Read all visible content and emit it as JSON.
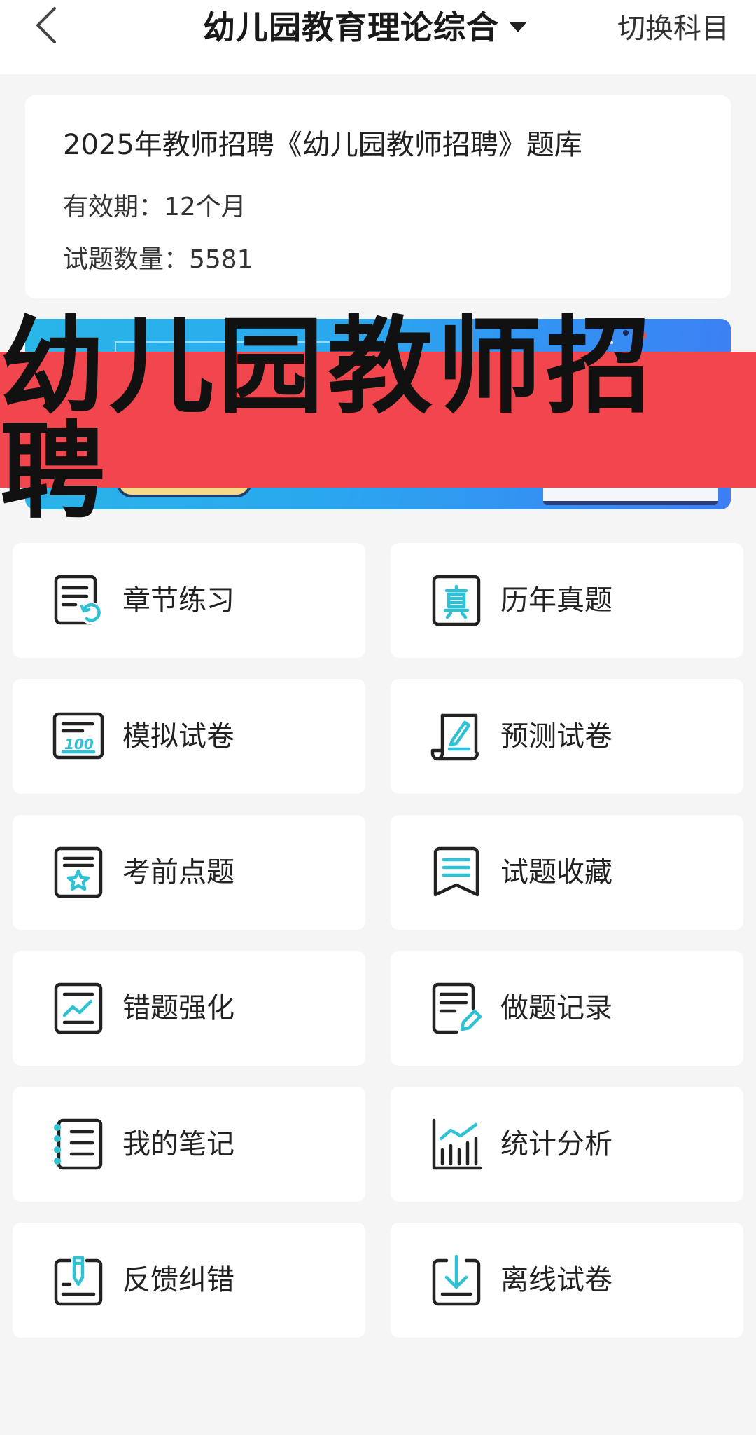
{
  "header": {
    "title": "幼儿园教育理论综合",
    "switch_label": "切换科目"
  },
  "info": {
    "title": "2025年教师招聘《幼儿园教师招聘》题库",
    "validity": "有效期：12个月",
    "count": "试题数量：5581"
  },
  "banner": {
    "overlay_text": "幼儿园教师招聘"
  },
  "menu": {
    "items": [
      {
        "label": "章节练习",
        "icon": "chapter-practice-icon"
      },
      {
        "label": "历年真题",
        "icon": "past-exams-icon"
      },
      {
        "label": "模拟试卷",
        "icon": "mock-paper-icon"
      },
      {
        "label": "预测试卷",
        "icon": "forecast-paper-icon"
      },
      {
        "label": "考前点题",
        "icon": "pre-exam-tips-icon"
      },
      {
        "label": "试题收藏",
        "icon": "favorites-icon"
      },
      {
        "label": "错题强化",
        "icon": "wrong-questions-icon"
      },
      {
        "label": "做题记录",
        "icon": "practice-record-icon"
      },
      {
        "label": "我的笔记",
        "icon": "notes-icon"
      },
      {
        "label": "统计分析",
        "icon": "statistics-icon"
      },
      {
        "label": "反馈纠错",
        "icon": "feedback-icon"
      },
      {
        "label": "离线试卷",
        "icon": "offline-paper-icon"
      }
    ]
  },
  "colors": {
    "accent": "#2fc1d4",
    "overlay": "#f2464e",
    "background": "#f5f5f5"
  }
}
